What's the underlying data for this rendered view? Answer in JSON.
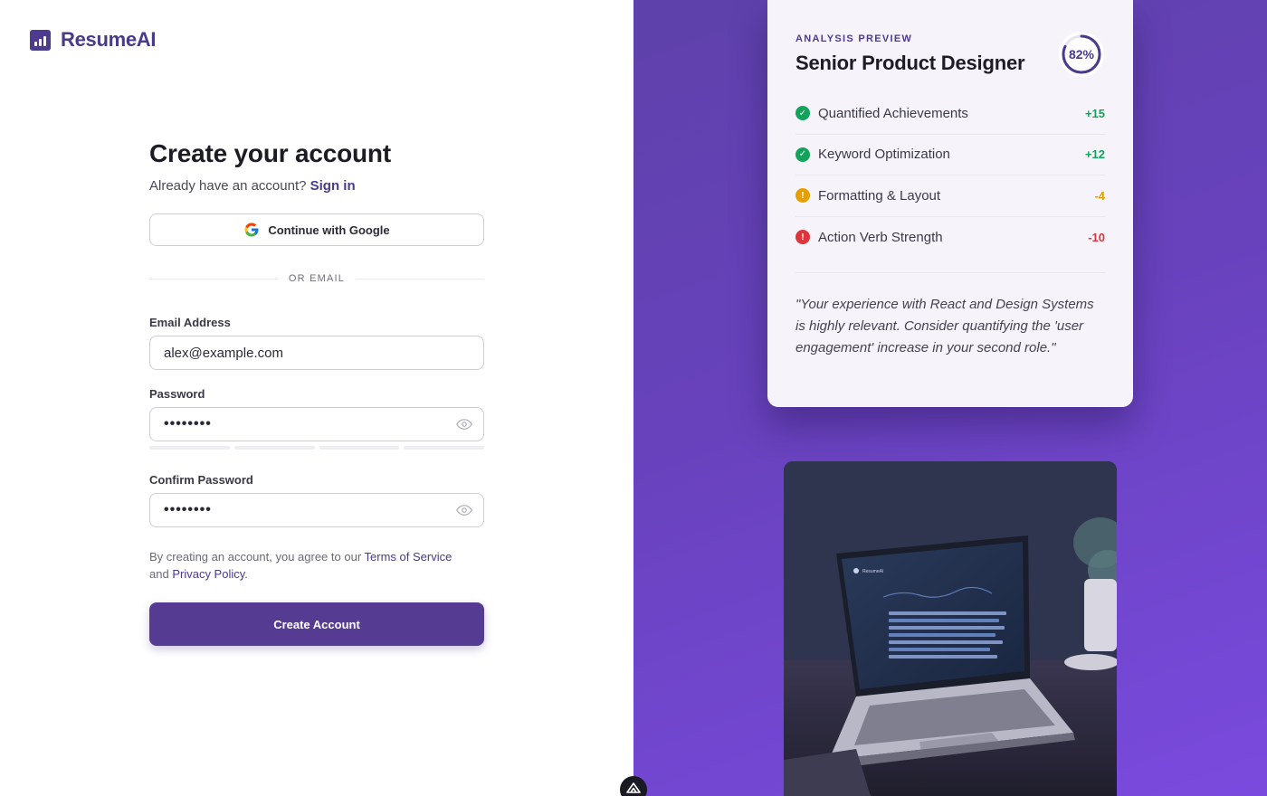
{
  "brand": {
    "name": "ResumeAI",
    "color": "#4f3a91"
  },
  "form": {
    "title": "Create your account",
    "signin_prompt": "Already have an account?",
    "signin_link": "Sign in",
    "google_button": "Continue with Google",
    "divider": "OR EMAIL",
    "email_label": "Email Address",
    "email_value": "alex@example.com",
    "password_label": "Password",
    "password_value": "••••••••",
    "confirm_label": "Confirm Password",
    "confirm_value": "••••••••",
    "terms_prefix": "By creating an account, you agree to our",
    "terms_link": "Terms of Service",
    "terms_and": "and",
    "privacy_link": "Privacy Policy",
    "terms_suffix": ".",
    "submit": "Create Account"
  },
  "preview": {
    "eyebrow": "ANALYSIS PREVIEW",
    "title": "Senior Product Designer",
    "score_label": "82%",
    "score_value": 0.82,
    "metrics": [
      {
        "label": "Quantified Achievements",
        "value": "+15",
        "status": "success",
        "icon": "check-circle-icon",
        "color": "#12a35a"
      },
      {
        "label": "Keyword Optimization",
        "value": "+12",
        "status": "success",
        "icon": "check-circle-icon",
        "color": "#12a35a"
      },
      {
        "label": "Formatting & Layout",
        "value": "-4",
        "status": "warning",
        "icon": "info-circle-icon",
        "color": "#e5a000"
      },
      {
        "label": "Action Verb Strength",
        "value": "-10",
        "status": "error",
        "icon": "alert-circle-icon",
        "color": "#e0343a"
      }
    ],
    "quote": "\"Your experience with React and Design Systems is highly relevant. Consider quantifying the 'user engagement' increase in your second role.\""
  },
  "photo": {
    "screen_brand": "ResumeAI"
  }
}
